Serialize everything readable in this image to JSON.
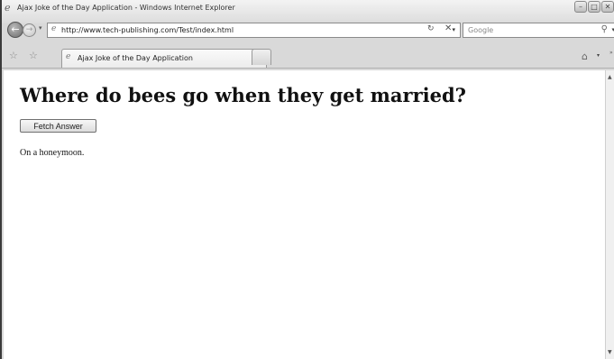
{
  "window": {
    "title": "Ajax Joke of the Day Application - Windows Internet Explorer",
    "controls": {
      "minimize": "–",
      "maximize": "□",
      "close": "✕"
    }
  },
  "toolbar": {
    "url": "http://www.tech-publishing.com/Test/index.html",
    "search_placeholder": "Google",
    "icons": {
      "back": "back-arrow-icon",
      "forward": "forward-arrow-icon",
      "refresh": "refresh-icon",
      "stop": "stop-icon",
      "search": "search-icon",
      "page": "page-icon"
    }
  },
  "tabs": [
    {
      "label": "Ajax Joke of the Day Application",
      "active": true
    }
  ],
  "page": {
    "joke": "Where do bees go when they get married?",
    "button_label": "Fetch Answer",
    "answer": "On a honeymoon."
  }
}
